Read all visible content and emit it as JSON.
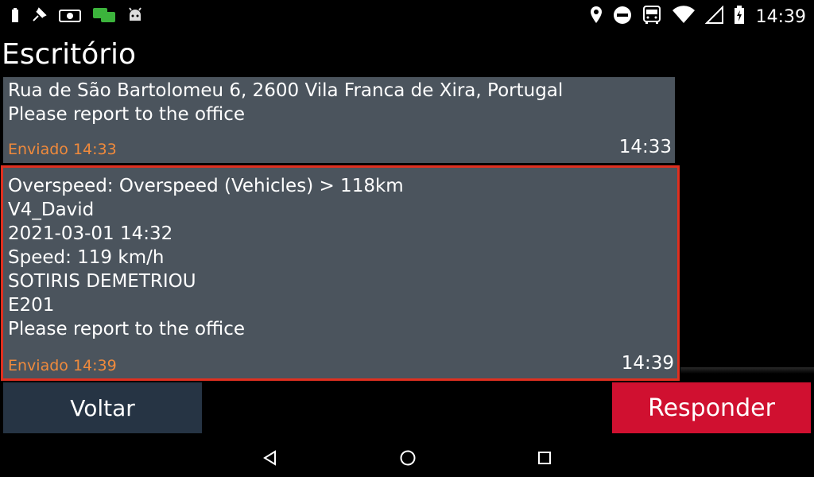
{
  "status_bar": {
    "left_icons": [
      "battery-small-icon",
      "pin-icon",
      "camera-toggle-icon",
      "chat-icon",
      "android-icon"
    ],
    "right_icons": [
      "location-icon",
      "do-not-disturb-icon",
      "bus-icon",
      "wifi-icon",
      "signal-icon",
      "battery-charging-icon"
    ],
    "time": "14:39"
  },
  "page": {
    "title": "Escritório"
  },
  "messages": [
    {
      "lines": [
        "Rua de São Bartolomeu 6, 2600 Vila Franca de Xira, Portugal",
        "Please report to the office"
      ],
      "sent_label": "Enviado 14:33",
      "time": "14:33",
      "selected": false
    },
    {
      "lines": [
        "Overspeed: Overspeed (Vehicles) > 118km",
        "V4_David",
        "2021-03-01 14:32",
        "Speed: 119 km/h",
        "SOTIRIS DEMETRIOU",
        "E201",
        "Please report to the office"
      ],
      "sent_label": "Enviado 14:39",
      "time": "14:39",
      "selected": true
    }
  ],
  "buttons": {
    "back": "Voltar",
    "reply": "Responder"
  },
  "colors": {
    "message_bg": "#4b545d",
    "sent_text": "#f08a3c",
    "selection_border": "#e03020",
    "back_button": "#263444",
    "reply_button": "#d01030"
  },
  "navbar": {
    "icons": [
      "back-triangle-icon",
      "home-circle-icon",
      "recents-square-icon"
    ]
  }
}
